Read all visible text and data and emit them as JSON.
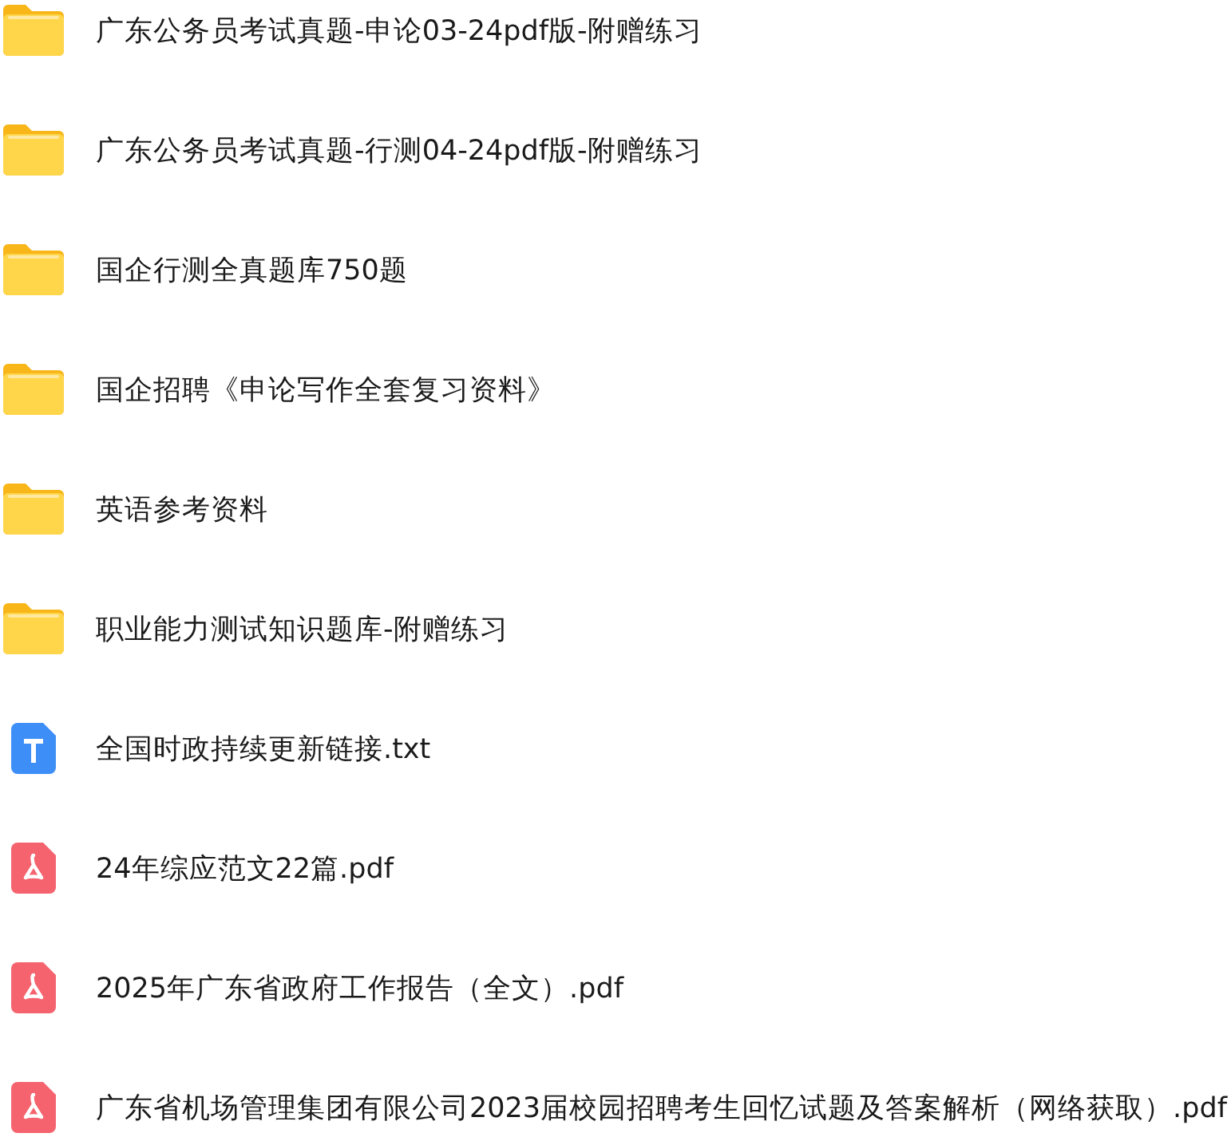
{
  "files": [
    {
      "kind": "folder",
      "name": "广东公务员考试真题-申论03-24pdf版-附赠练习"
    },
    {
      "kind": "folder",
      "name": "广东公务员考试真题-行测04-24pdf版-附赠练习"
    },
    {
      "kind": "folder",
      "name": "国企行测全真题库750题"
    },
    {
      "kind": "folder",
      "name": "国企招聘《申论写作全套复习资料》"
    },
    {
      "kind": "folder",
      "name": "英语参考资料"
    },
    {
      "kind": "folder",
      "name": "职业能力测试知识题库-附赠练习"
    },
    {
      "kind": "txt",
      "name": "全国时政持续更新链接.txt"
    },
    {
      "kind": "pdf",
      "name": "24年综应范文22篇.pdf"
    },
    {
      "kind": "pdf",
      "name": "2025年广东省政府工作报告（全文）.pdf"
    },
    {
      "kind": "pdf",
      "name": "广东省机场管理集团有限公司2023届校园招聘考生回忆试题及答案解析（网络获取）.pdf"
    }
  ]
}
